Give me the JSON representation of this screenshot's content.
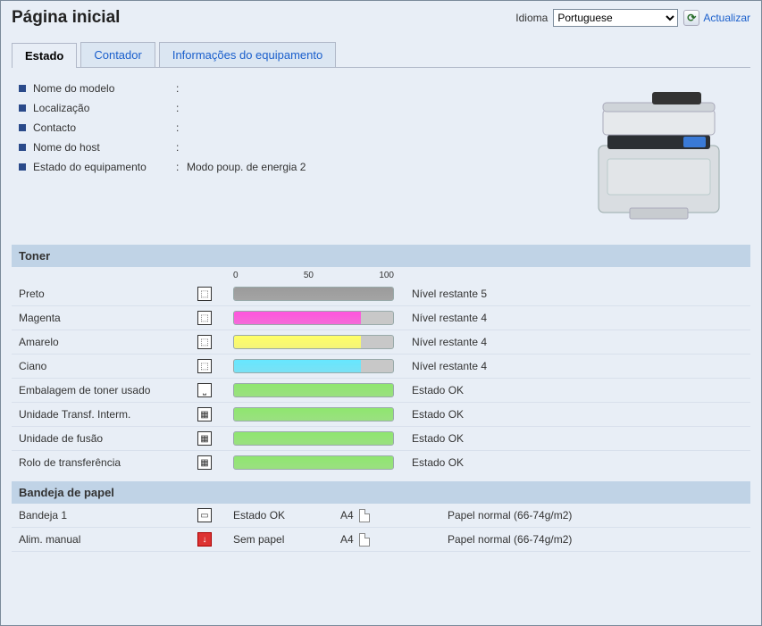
{
  "header": {
    "title": "Página inicial",
    "lang_label": "Idioma",
    "lang_selected": "Portuguese",
    "refresh_label": "Actualizar"
  },
  "tabs": [
    {
      "label": "Estado",
      "active": true
    },
    {
      "label": "Contador",
      "active": false
    },
    {
      "label": "Informações do equipamento",
      "active": false
    }
  ],
  "info": [
    {
      "label": "Nome do modelo",
      "value": ""
    },
    {
      "label": "Localização",
      "value": ""
    },
    {
      "label": "Contacto",
      "value": ""
    },
    {
      "label": "Nome do host",
      "value": ""
    },
    {
      "label": "Estado do equipamento",
      "value": "Modo poup. de energia 2"
    }
  ],
  "toner_section": {
    "title": "Toner",
    "ruler": {
      "min": "0",
      "mid": "50",
      "max": "100"
    },
    "rows": [
      {
        "name": "Preto",
        "icon": "toner",
        "fill": 100,
        "color": "#9b9b9b",
        "status": "Nível restante 5"
      },
      {
        "name": "Magenta",
        "icon": "toner",
        "fill": 80,
        "color": "#ff55dd",
        "status": "Nível restante 4"
      },
      {
        "name": "Amarelo",
        "icon": "toner",
        "fill": 80,
        "color": "#ffff66",
        "status": "Nível restante 4"
      },
      {
        "name": "Ciano",
        "icon": "toner",
        "fill": 80,
        "color": "#66e7ff",
        "status": "Nível restante 4"
      },
      {
        "name": "Embalagem de toner usado",
        "icon": "waste",
        "fill": 100,
        "color": "#8fe66f",
        "status": "Estado OK"
      },
      {
        "name": "Unidade Transf. Interm.",
        "icon": "unit",
        "fill": 100,
        "color": "#8fe66f",
        "status": "Estado OK"
      },
      {
        "name": "Unidade de fusão",
        "icon": "unit",
        "fill": 100,
        "color": "#8fe66f",
        "status": "Estado OK"
      },
      {
        "name": "Rolo de transferência",
        "icon": "unit",
        "fill": 100,
        "color": "#8fe66f",
        "status": "Estado OK"
      }
    ]
  },
  "tray_section": {
    "title": "Bandeja de papel",
    "rows": [
      {
        "name": "Bandeja 1",
        "icon": "tray",
        "icon_alert": false,
        "state": "Estado OK",
        "size": "A4",
        "type": "Papel normal (66-74g/m2)"
      },
      {
        "name": "Alim. manual",
        "icon": "tray",
        "icon_alert": true,
        "state": "Sem papel",
        "size": "A4",
        "type": "Papel normal (66-74g/m2)"
      }
    ]
  }
}
